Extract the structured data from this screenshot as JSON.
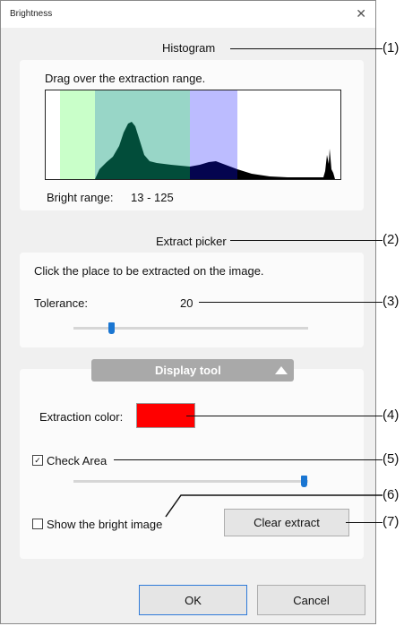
{
  "window": {
    "title": "Brightness",
    "close_glyph": "✕"
  },
  "histogram": {
    "section_label": "Histogram",
    "instruction": "Drag over the extraction range.",
    "range_label": "Bright range:",
    "range_value": "13 - 125",
    "colors": {
      "green": "#c9ffc9",
      "teal": "#98d6c7",
      "blue": "#bcbcff",
      "fill_dark": "#024d3a",
      "fill_blue": "#04044f"
    }
  },
  "extract_picker": {
    "section_label": "Extract picker",
    "instruction": "Click the place to be extracted on the image.",
    "tolerance_label": "Tolerance:",
    "tolerance_value": "20"
  },
  "display_tool": {
    "label": "Display tool",
    "extraction_color_label": "Extraction color:",
    "extraction_color": "#ff0000",
    "check_area_label": "Check Area",
    "check_area_checked": true,
    "show_bright_label": "Show the bright image",
    "show_bright_checked": false,
    "clear_button": "Clear extract"
  },
  "buttons": {
    "ok": "OK",
    "cancel": "Cancel"
  },
  "callouts": [
    "(1)",
    "(2)",
    "(3)",
    "(4)",
    "(5)",
    "(6)",
    "(7)"
  ]
}
